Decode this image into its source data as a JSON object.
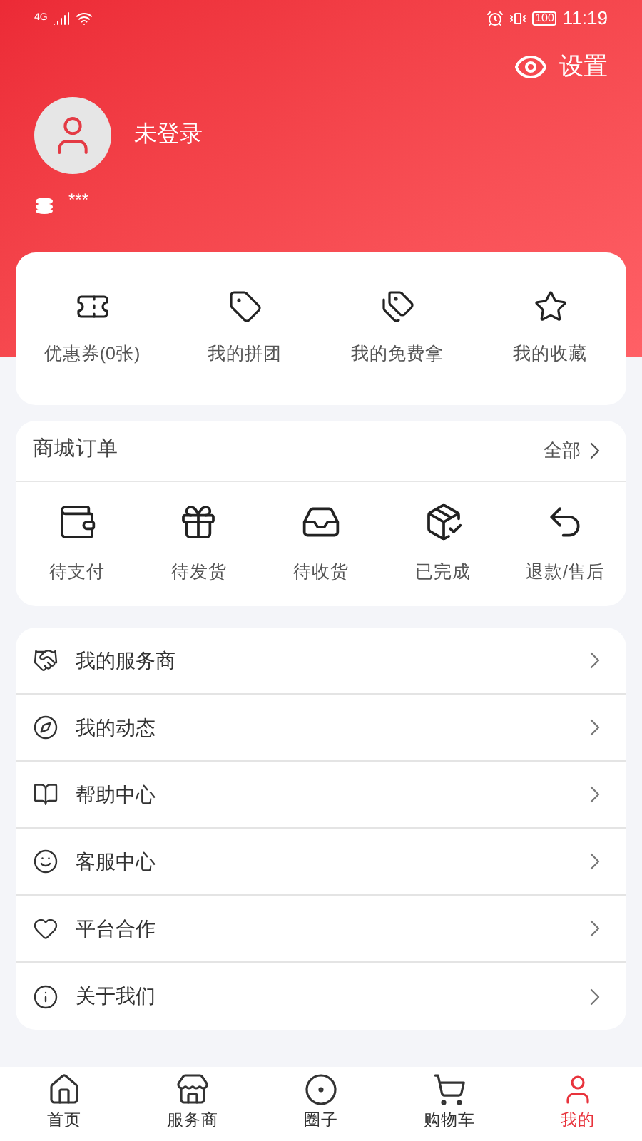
{
  "status_bar": {
    "network": "4G",
    "battery": "100",
    "time": "11:19"
  },
  "header": {
    "settings": "设置",
    "username": "未登录",
    "coins": "***"
  },
  "shortcuts": [
    {
      "kind": "ticket",
      "label": "优惠券(0张)"
    },
    {
      "kind": "tag",
      "label": "我的拼团"
    },
    {
      "kind": "free",
      "label": "我的免费拿"
    },
    {
      "kind": "star",
      "label": "我的收藏"
    }
  ],
  "orders": {
    "title": "商城订单",
    "all": "全部",
    "items": [
      {
        "kind": "wallet",
        "label": "待支付"
      },
      {
        "kind": "ship",
        "label": "待发货"
      },
      {
        "kind": "receive",
        "label": "待收货"
      },
      {
        "kind": "done",
        "label": "已完成"
      },
      {
        "kind": "refund",
        "label": "退款/售后"
      }
    ]
  },
  "menu": [
    {
      "kind": "handshake",
      "label": "我的服务商"
    },
    {
      "kind": "dynamic",
      "label": "我的动态"
    },
    {
      "kind": "book",
      "label": "帮助中心"
    },
    {
      "kind": "service",
      "label": "客服中心"
    },
    {
      "kind": "heart",
      "label": "平台合作"
    },
    {
      "kind": "info",
      "label": "关于我们"
    }
  ],
  "tab_bar": [
    {
      "kind": "home",
      "label": "首页",
      "selected": false
    },
    {
      "kind": "store",
      "label": "服务商",
      "selected": false
    },
    {
      "kind": "circle",
      "label": "圈子",
      "selected": false
    },
    {
      "kind": "cart",
      "label": "购物车",
      "selected": false
    },
    {
      "kind": "user",
      "label": "我的",
      "selected": true
    }
  ]
}
